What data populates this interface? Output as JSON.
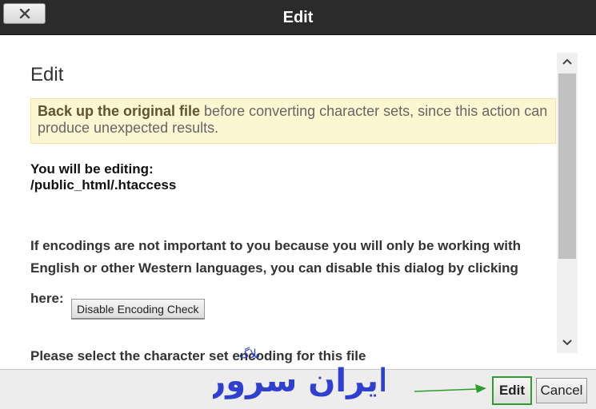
{
  "dialog": {
    "title": "Edit",
    "close_icon": "close-x-icon"
  },
  "content": {
    "heading": "Edit",
    "alert": {
      "bold": "Back up the original file",
      "rest": " before converting character sets, since this action can produce unexpected results."
    },
    "editing_label": "You will be editing:",
    "editing_path": "/public_html/.htaccess",
    "encoding_text": "If encodings are not important to you because you will only be working with English or other Western languages, you can disable this dialog by clicking",
    "here_label": "here:",
    "disable_button": "Disable Encoding Check",
    "cutoff_text": "Please select the character set encoding for this file"
  },
  "scrollbar": {
    "up_icon": "chevron-up-icon",
    "down_icon": "chevron-down-icon"
  },
  "footer": {
    "edit_button": "Edit",
    "cancel_button": "Cancel"
  },
  "watermark": {
    "small_text": "بلاگ",
    "large_text": "ایران سرور",
    "color": "#2f3fcf"
  },
  "colors": {
    "titlebar_bg": "#2b2b2b",
    "alert_bg": "#fcf6d1",
    "highlight": "#2e9d2e"
  }
}
